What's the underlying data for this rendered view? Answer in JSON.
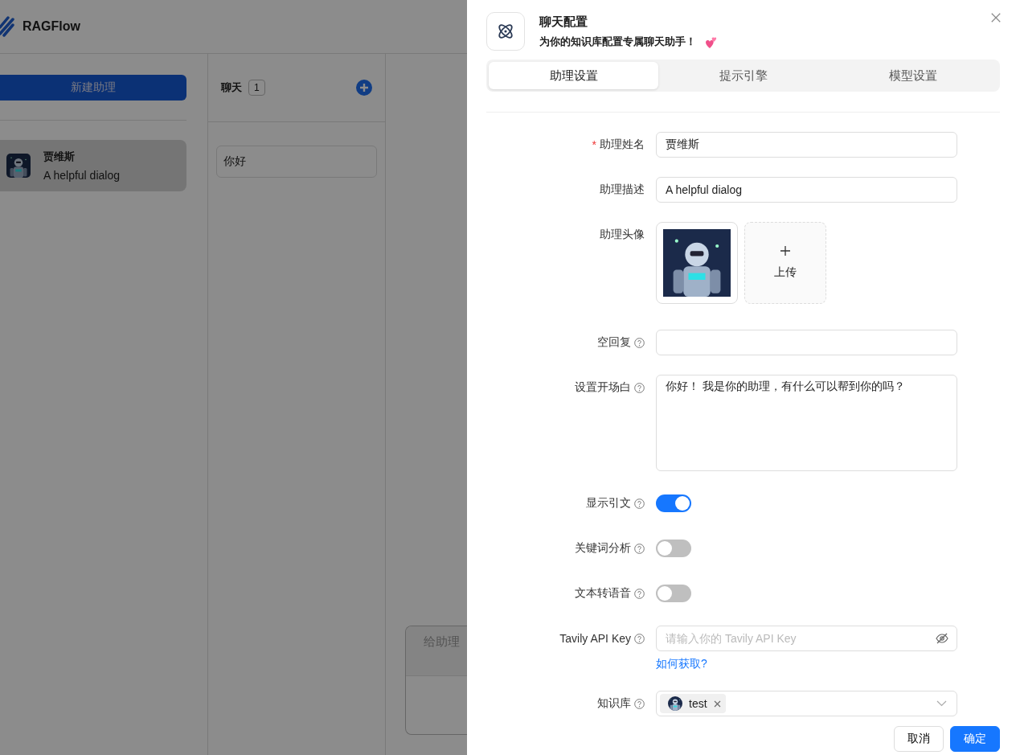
{
  "app": {
    "brand": "RAGFlow",
    "new_button": "新建助理",
    "assistants": [
      {
        "name": "贾维斯",
        "description": "A helpful dialog",
        "selected": true
      }
    ],
    "chat_title": "聊天",
    "chat_count": "1",
    "conversations": [
      {
        "title": "你好"
      }
    ],
    "message_placeholder": "给助理"
  },
  "drawer": {
    "title": "聊天配置",
    "subtitle": "为你的知识库配置专属聊天助手！",
    "tabs": [
      {
        "label": "助理设置",
        "selected": true
      },
      {
        "label": "提示引擎",
        "selected": false
      },
      {
        "label": "模型设置",
        "selected": false
      }
    ],
    "fields": [
      {
        "kind": "text",
        "label": "助理姓名",
        "required_mark": "*",
        "help": false,
        "value": "贾维斯"
      },
      {
        "kind": "text",
        "label": "助理描述",
        "help": false,
        "value": "A helpful dialog"
      },
      {
        "kind": "avatar",
        "label": "助理头像",
        "help": false,
        "upload": "上传"
      },
      {
        "kind": "text",
        "label": "空回复",
        "help": true
      },
      {
        "kind": "textarea",
        "label": "设置开场白",
        "help": true,
        "value": "你好！ 我是你的助理，有什么可以帮到你的吗？"
      },
      {
        "kind": "switch",
        "label": "显示引文",
        "help": true,
        "on": true
      },
      {
        "kind": "switch",
        "label": "关键词分析",
        "help": true,
        "on": false
      },
      {
        "kind": "switch",
        "label": "文本转语音",
        "help": true,
        "on": false
      },
      {
        "kind": "password",
        "label": "Tavily API Key",
        "help": true,
        "placeholder": "请输入你的 Tavily API Key",
        "link": "如何获取?"
      },
      {
        "kind": "select",
        "label": "知识库",
        "help": true,
        "tags": [
          "test"
        ]
      }
    ],
    "buttons": [
      {
        "label": "取消",
        "primary": false
      },
      {
        "label": "确定",
        "primary": true
      }
    ]
  }
}
